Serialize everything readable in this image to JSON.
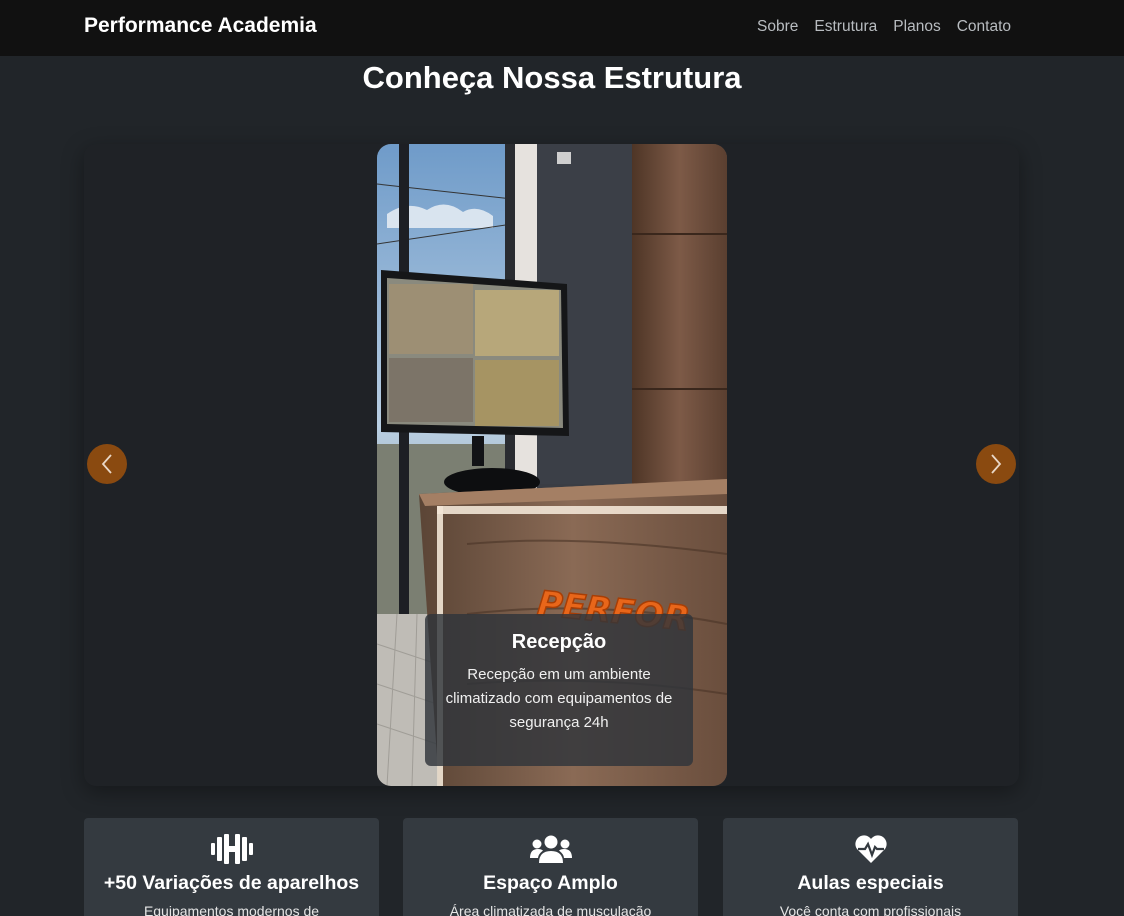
{
  "brand": "Performance Academia",
  "nav": {
    "items": [
      "Sobre",
      "Estrutura",
      "Planos",
      "Contato"
    ]
  },
  "section": {
    "title": "Conheça Nossa Estrutura"
  },
  "carousel": {
    "slide": {
      "title": "Recepção",
      "description": "Recepção em um ambiente climatizado com equipamentos de segurança 24h",
      "sign_text": "PERFOR"
    },
    "prev_icon": "chevron-left-icon",
    "next_icon": "chevron-right-icon",
    "arrow_color": "#8a4a10"
  },
  "features": [
    {
      "icon": "dumbbell-icon",
      "title": "+50 Variações de aparelhos",
      "text": "Equipamentos modernos de"
    },
    {
      "icon": "users-icon",
      "title": "Espaço Amplo",
      "text": "Área climatizada de musculação"
    },
    {
      "icon": "heartbeat-icon",
      "title": "Aulas especiais",
      "text": "Você conta com profissionais"
    }
  ],
  "colors": {
    "navbar": "#111111",
    "background": "#212529",
    "card": "#343a40",
    "accent": "#e8661a"
  }
}
